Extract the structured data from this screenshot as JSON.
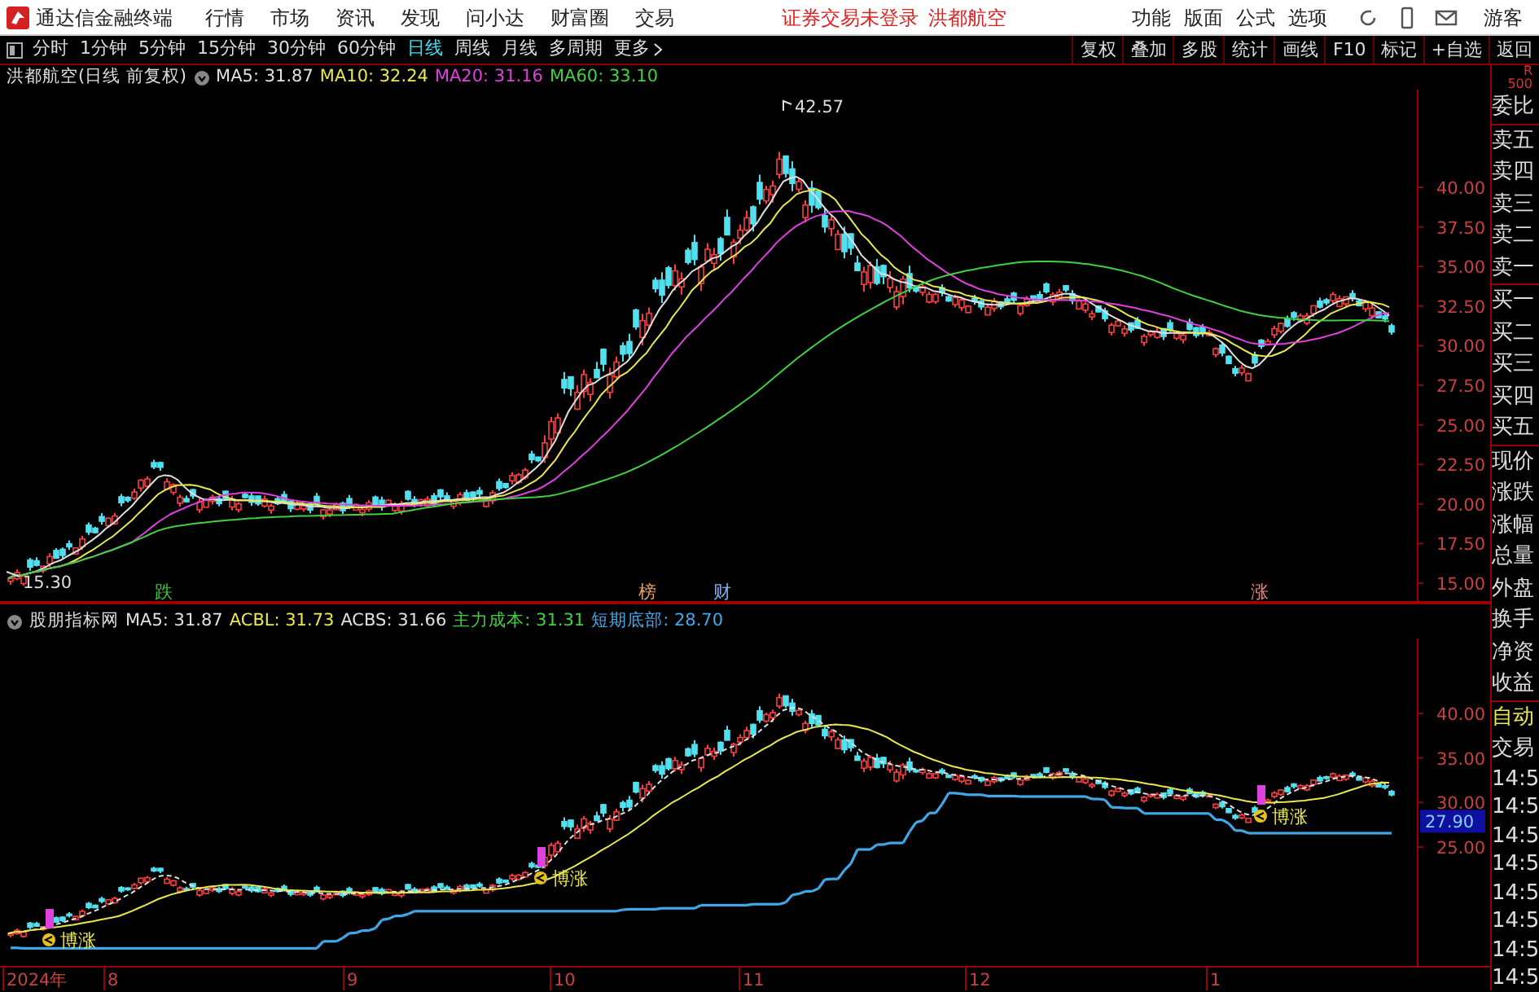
{
  "menubar": {
    "app_name": "通达信金融终端",
    "menus": [
      "行情",
      "市场",
      "资讯",
      "发现",
      "问小达",
      "财富圈",
      "交易"
    ],
    "notice": "证券交易未登录",
    "stock": "洪都航空",
    "tools": [
      "功能",
      "版面",
      "公式",
      "选项"
    ],
    "user": "游客"
  },
  "period_bar": {
    "periods": [
      {
        "label": "分时",
        "selected": false
      },
      {
        "label": "1分钟",
        "selected": false
      },
      {
        "label": "5分钟",
        "selected": false
      },
      {
        "label": "15分钟",
        "selected": false
      },
      {
        "label": "30分钟",
        "selected": false
      },
      {
        "label": "60分钟",
        "selected": false
      },
      {
        "label": "日线",
        "selected": true
      },
      {
        "label": "周线",
        "selected": false
      },
      {
        "label": "月线",
        "selected": false
      },
      {
        "label": "多周期",
        "selected": false
      }
    ],
    "more": "更多",
    "buttons": [
      "复权",
      "叠加",
      "多股",
      "统计",
      "画线",
      "F10",
      "标记",
      "+自选",
      "返回"
    ]
  },
  "main_chart": {
    "title": "洪都航空(日线 前复权)",
    "indicators": [
      {
        "label": "MA5: 31.87",
        "color": "#e0e0e0"
      },
      {
        "label": "MA10: 32.24",
        "color": "#e8e850"
      },
      {
        "label": "MA20: 31.16",
        "color": "#e040e0"
      },
      {
        "label": "MA60: 33.10",
        "color": "#40d040"
      }
    ],
    "yticks": [
      "40.00",
      "37.50",
      "35.00",
      "32.50",
      "30.00",
      "27.50",
      "25.00",
      "22.50",
      "20.00",
      "17.50",
      "15.00"
    ],
    "high_label": "42.57",
    "low_label": "15.30",
    "signals": [
      {
        "text": "跌",
        "color": "#40c040"
      },
      {
        "text": "榜",
        "color": "#e0a060"
      },
      {
        "text": "财",
        "color": "#80b0f0"
      },
      {
        "text": "涨",
        "color": "#f08080"
      }
    ]
  },
  "sub_chart": {
    "title": "股朋指标网",
    "indicators": [
      {
        "label": "MA5: 31.87",
        "color": "#e0e0e0"
      },
      {
        "label": "ACBL: 31.73",
        "color": "#e8e850"
      },
      {
        "label": "ACBS: 31.66",
        "color": "#e0e0e0"
      },
      {
        "label": "主力成本: 31.31",
        "color": "#40d040"
      },
      {
        "label": "短期底部: 28.70",
        "color": "#40a8e8"
      }
    ],
    "yticks": [
      "40.00",
      "35.00",
      "30.00",
      "25.00"
    ],
    "badge": "27.90",
    "markers": [
      "博涨",
      "博涨",
      "博涨"
    ]
  },
  "x_axis": [
    "2024年",
    "8",
    "9",
    "10",
    "11",
    "12",
    "1"
  ],
  "side_panel": {
    "corner": [
      "R",
      "500"
    ],
    "quote_labels": [
      "委比",
      "卖五",
      "卖四",
      "卖三",
      "卖二",
      "卖一",
      "买一",
      "买二",
      "买三",
      "买四",
      "买五",
      "现价",
      "涨跌",
      "涨幅",
      "总量",
      "外盘",
      "换手",
      "净资",
      "收益"
    ],
    "auto": "自动",
    "trade": "交易",
    "times": [
      "14:5",
      "14:5",
      "14:5",
      "14:5",
      "14:5",
      "14:5",
      "14:5",
      "14:5"
    ]
  }
}
